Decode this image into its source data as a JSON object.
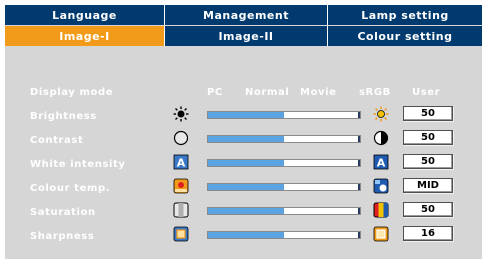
{
  "tabs_row1": [
    {
      "label": "Language",
      "active": false
    },
    {
      "label": "Management",
      "active": false
    },
    {
      "label": "Lamp setting",
      "active": false
    }
  ],
  "tabs_row2": [
    {
      "label": "Image-I",
      "active": true
    },
    {
      "label": "Image-II",
      "active": false
    },
    {
      "label": "Colour setting",
      "active": false
    }
  ],
  "display_mode": {
    "label": "Display mode",
    "options": [
      "PC",
      "Normal",
      "Movie",
      "sRGB",
      "User"
    ]
  },
  "settings": [
    {
      "label": "Brightness",
      "value": "50",
      "left_icon": "sun-dim-icon",
      "right_icon": "sun-bright-icon",
      "level": 0.5
    },
    {
      "label": "Contrast",
      "value": "50",
      "left_icon": "contrast-low-icon",
      "right_icon": "contrast-high-icon",
      "level": 0.5
    },
    {
      "label": "White intensity",
      "value": "50",
      "left_icon": "white-intensity-low-icon",
      "right_icon": "white-intensity-high-icon",
      "level": 0.5
    },
    {
      "label": "Colour temp.",
      "value": "MID",
      "left_icon": "colour-temp-warm-icon",
      "right_icon": "colour-temp-cool-icon",
      "level": 0.5
    },
    {
      "label": "Saturation",
      "value": "50",
      "left_icon": "saturation-low-icon",
      "right_icon": "saturation-high-icon",
      "level": 0.5
    },
    {
      "label": "Sharpness",
      "value": "16",
      "left_icon": "sharpness-low-icon",
      "right_icon": "sharpness-high-icon",
      "level": 0.5
    }
  ],
  "colors": {
    "tab_bg": "#003a6e",
    "tab_active": "#f29a1a",
    "panel_bg": "#d6d6d6",
    "bar_fill": "#5aa3e0"
  }
}
